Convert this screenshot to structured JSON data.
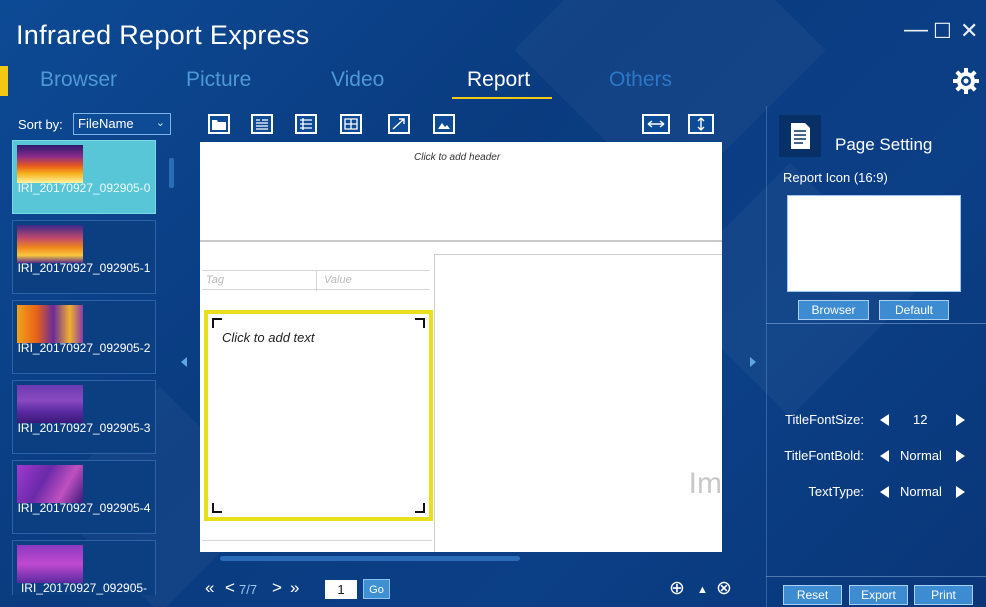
{
  "app": {
    "title": "Infrared Report Express",
    "window_controls": {
      "minimize": "—",
      "maximize": "☐",
      "close": "✕"
    }
  },
  "tabs": [
    {
      "label": "Browser",
      "active": false
    },
    {
      "label": "Picture",
      "active": false
    },
    {
      "label": "Video",
      "active": false
    },
    {
      "label": "Report",
      "active": true
    },
    {
      "label": "Others",
      "active": false
    }
  ],
  "sidebar": {
    "sort_label": "Sort by:",
    "sort_value": "FileName",
    "thumbnails": [
      {
        "caption": "IRI_20170927_092905-0",
        "selected": true
      },
      {
        "caption": "IRI_20170927_092905-1",
        "selected": false
      },
      {
        "caption": "IRI_20170927_092905-2",
        "selected": false
      },
      {
        "caption": "IRI_20170927_092905-3",
        "selected": false
      },
      {
        "caption": "IRI_20170927_092905-4",
        "selected": false
      },
      {
        "caption": "IRI_20170927_092905-",
        "selected": false
      }
    ]
  },
  "report": {
    "header_hint": "Click to add header",
    "table_tag": "Tag",
    "table_value": "Value",
    "text_hint": "Click to add text",
    "image_hint": "Im"
  },
  "pager": {
    "first": "«",
    "prev": "<",
    "page_text": "7/7",
    "next": ">",
    "last": "»",
    "page_input": "1",
    "go": "Go",
    "zoom_in": "⊕",
    "up": "▲",
    "zoom_out": "⊗"
  },
  "settings": {
    "title": "Page Setting",
    "report_icon_label": "Report Icon (16:9)",
    "browser_button": "Browser",
    "default_button": "Default",
    "title_font_size_label": "TitleFontSize:",
    "title_font_size_value": "12",
    "title_font_bold_label": "TitleFontBold:",
    "title_font_bold_value": "Normal",
    "text_type_label": "TextType:",
    "text_type_value": "Normal",
    "reset": "Reset",
    "export": "Export",
    "print": "Print"
  },
  "colors": {
    "accent": "#f2c814",
    "background": "#0b3a7c",
    "selected_thumb": "#58c6d6",
    "button": "#3d8bd1"
  }
}
